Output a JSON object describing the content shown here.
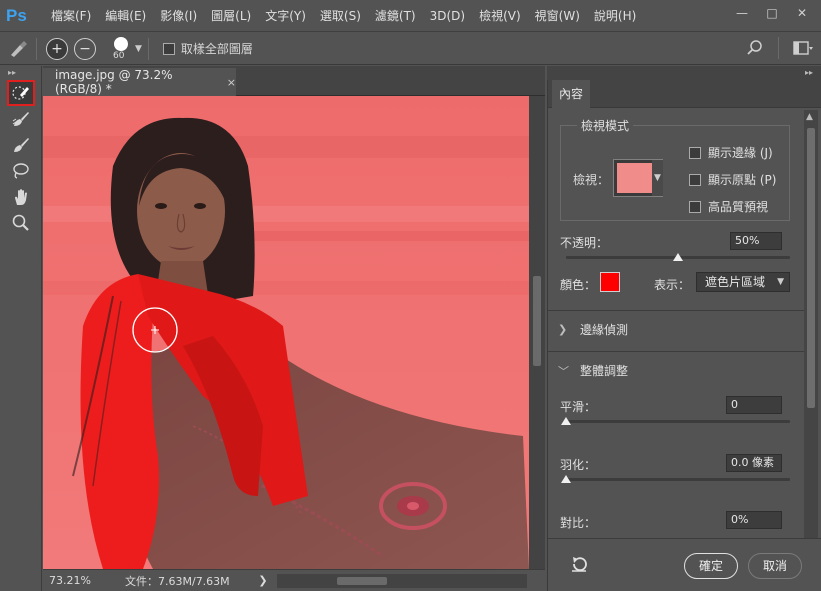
{
  "app": {
    "logo": "Ps"
  },
  "menu": [
    "檔案(F)",
    "編輯(E)",
    "影像(I)",
    "圖層(L)",
    "文字(Y)",
    "選取(S)",
    "濾鏡(T)",
    "3D(D)",
    "檢視(V)",
    "視窗(W)",
    "說明(H)"
  ],
  "window_controls": {
    "minimize": "—",
    "maximize": "□",
    "close": "✕"
  },
  "options": {
    "brush_size": "60",
    "sample_all_layers_label": "取樣全部圖層",
    "add_mode": "+",
    "subtract_mode": "−"
  },
  "document": {
    "tab_title": "image.jpg @ 73.2% (RGB/8) *",
    "close_glyph": "×"
  },
  "status": {
    "zoom": "73.21%",
    "doc_info": "文件：7.63M/7.63M",
    "arrow": "❯"
  },
  "panel": {
    "tab_label": "內容",
    "view_mode_title": "檢視模式",
    "view_label": "檢視：",
    "show_edge_label": "顯示邊緣 (J)",
    "show_original_label": "顯示原點 (P)",
    "hq_preview_label": "高品質預視",
    "opacity_label": "不透明：",
    "opacity_value": "50%",
    "opacity_fraction": 0.5,
    "color_label": "顏色：",
    "overlay_color": "#ff0000",
    "show_label": "表示：",
    "show_value": "遮色片區域",
    "edge_detection_label": "邊緣偵測",
    "global_refine_label": "整體調整",
    "smooth_label": "平滑：",
    "smooth_value": "0",
    "feather_label": "羽化：",
    "feather_value": "0.0 像素",
    "contrast_label": "對比：",
    "contrast_value": "0%",
    "ok_label": "確定",
    "cancel_label": "取消"
  },
  "colors": {
    "ui_bg": "#535353",
    "accent_logo": "#3ea3f0",
    "selected_tool_border": "#e0201e",
    "overlay_red": "#ff0000"
  },
  "icons": [
    "quick-selection-brush-icon",
    "refine-edge-brush-icon",
    "brush-icon",
    "lasso-icon",
    "hand-icon",
    "zoom-icon",
    "search-icon",
    "workspace-icon",
    "reset-icon"
  ]
}
